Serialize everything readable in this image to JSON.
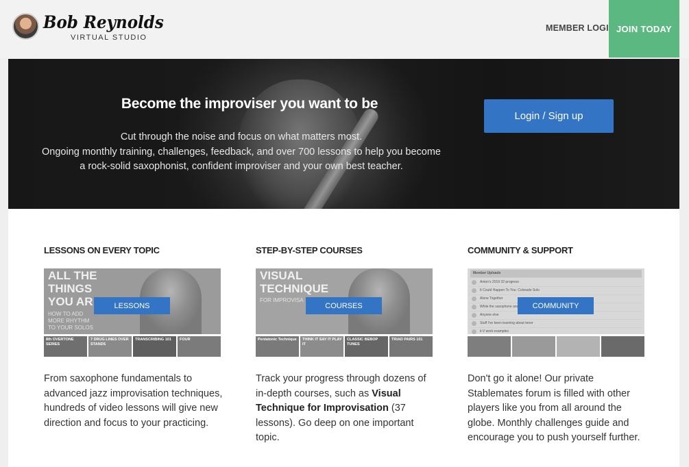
{
  "header": {
    "logo_name": "Bob Reynolds",
    "logo_sub": "VIRTUAL STUDIO",
    "member_login": "MEMBER LOGIN",
    "join_today": "JOIN TODAY"
  },
  "hero": {
    "title": "Become the improviser you want to be",
    "line1": "Cut through the noise and focus on what matters most.",
    "line2": "Ongoing monthly training, challenges, feedback, and over 700 lessons to help you become",
    "line3": "a rock-solid saxophonist, confident improviser and your own best teacher.",
    "signup": "Login / Sign up"
  },
  "columns": [
    {
      "title": "LESSONS ON EVERY TOPIC",
      "button": "LESSONS",
      "thumb_big": [
        "ALL THE",
        "THINGS",
        "YOU AR"
      ],
      "thumb_small": [
        "HOW TO ADD",
        "MORE RHYTHM",
        "TO YOUR SOLOS"
      ],
      "tiles": [
        "8th OVERTONE SERIES",
        "7 DRUG LINES OVER STANDS",
        "TRANSCRIBING 101",
        "FOUR"
      ],
      "desc": "From saxophone fundamentals to advanced jazz improvisation techniques, hundreds of video lessons will give new direction and focus to your practicing."
    },
    {
      "title": "STEP-BY-STEP COURSES",
      "button": "COURSES",
      "thumb_big": [
        "VISUAL",
        "TECHNIQUE"
      ],
      "thumb_small": [
        "FOR IMPROVISA"
      ],
      "tiles": [
        "Pentatonic Technique",
        "THINK IT SAY IT PLAY IT",
        "CLASSIC BEBOP TUNES",
        "TRIAD PAIRS 101"
      ],
      "desc_pre": "Track your progress through dozens of in-depth courses, such as ",
      "desc_bold": "Visual Technique for Improvisation",
      "desc_post": " (37 lessons). Go deep on one important topic."
    },
    {
      "title": "COMMUNITY & SUPPORT",
      "button": "COMMUNITY",
      "forum_rows": [
        "Member Uploads",
        "Anton's 2019 32 progress",
        "It Could Happen To You: Colorado Solo",
        "Alone Together",
        "While the saxophone and altissimo",
        "Anyone else",
        "Stuff I've been learning about tenor",
        "ii-V work examples"
      ],
      "desc": "Don't go it alone! Our private Stablemates forum is filled with other players like you from all around the globe. Monthly challenges guide and encourage you to push yourself further."
    }
  ],
  "colors": {
    "join_green": "#5ab880",
    "accent_blue": "#3474c4",
    "hero_bg": "#1b1b1b"
  }
}
